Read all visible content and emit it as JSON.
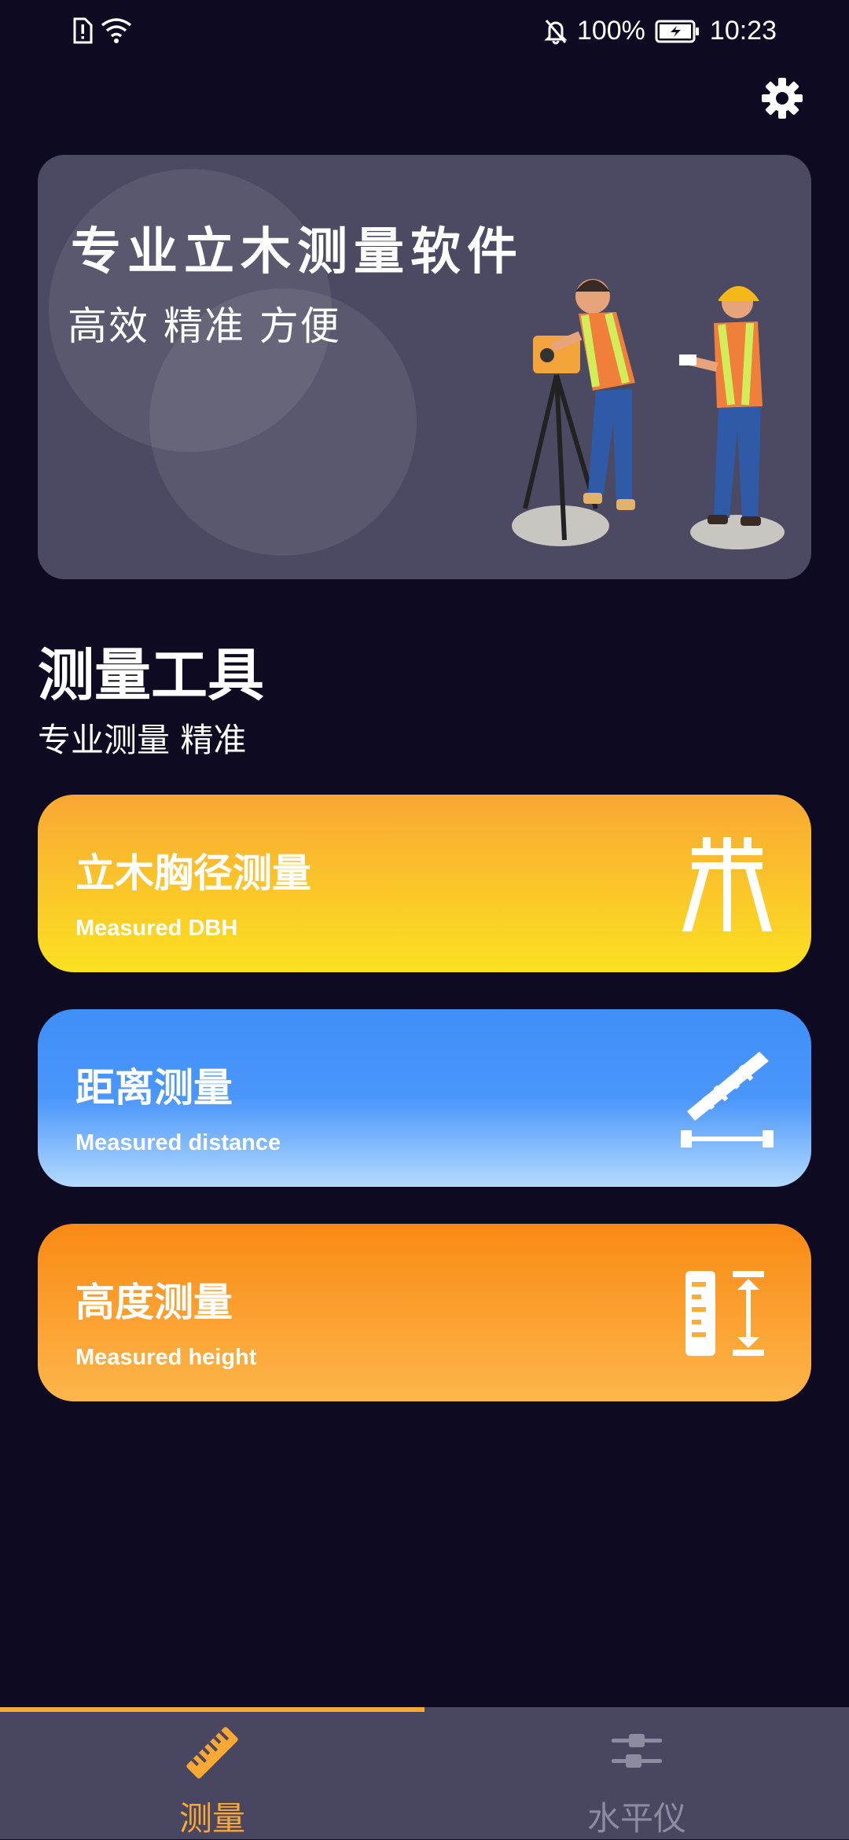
{
  "status_bar": {
    "battery": "100%",
    "time": "10:23"
  },
  "banner": {
    "title": "专业立木测量软件",
    "subtitle": "高效 精准 方便"
  },
  "section": {
    "title": "测量工具",
    "subtitle": "专业测量  精准"
  },
  "cards": [
    {
      "title": "立木胸径测量",
      "subtitle": "Measured DBH",
      "icon": "tripod-icon"
    },
    {
      "title": "距离测量",
      "subtitle": "Measured distance",
      "icon": "ruler-distance-icon"
    },
    {
      "title": "高度测量",
      "subtitle": "Measured height",
      "icon": "height-scale-icon"
    }
  ],
  "tabs": [
    {
      "label": "测量",
      "active": true,
      "icon": "ruler-icon"
    },
    {
      "label": "水平仪",
      "active": false,
      "icon": "level-icon"
    }
  ],
  "colors": {
    "background": "#0d0a22",
    "accent": "#f9a834",
    "tabbar": "#484660",
    "inactive_tab": "#8d8ba0"
  }
}
